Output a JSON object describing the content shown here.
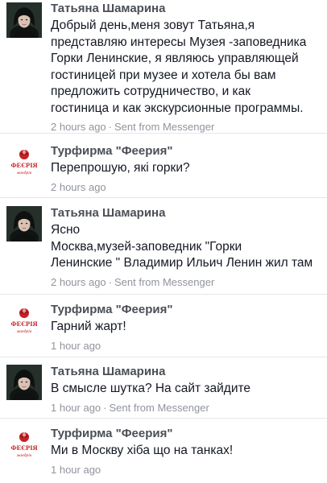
{
  "messages": [
    {
      "sender": "Татьяна Шамарина",
      "avatar": "woman-avatar",
      "lines": [
        "Добрый день,меня зовут Татьяна,я",
        "представляю интересы Музея -заповедника",
        "Горки Ленинские, я являюсь управляющей",
        "гостиницей при музее и хотела бы вам",
        "предложить сотрудничество, и как",
        "гостиница и как экскурсионные программы."
      ],
      "time": "2 hours ago",
      "source": "Sent from Messenger"
    },
    {
      "sender": "Турфирма \"Феерия\"",
      "avatar": "feeria-logo",
      "lines": [
        "Перепрошую, які горки?"
      ],
      "time": "2 hours ago",
      "source": ""
    },
    {
      "sender": "Татьяна Шамарина",
      "avatar": "woman-avatar",
      "lines": [
        "Ясно",
        "Москва,музей-заповедник \"Горки",
        "Ленинские \" Владимир Ильич Ленин жил там"
      ],
      "time": "2 hours ago",
      "source": "Sent from Messenger"
    },
    {
      "sender": "Турфирма \"Феерия\"",
      "avatar": "feeria-logo",
      "lines": [
        "Гарний жарт!"
      ],
      "time": "1 hour ago",
      "source": ""
    },
    {
      "sender": "Татьяна Шамарина",
      "avatar": "woman-avatar",
      "lines": [
        "В смысле шутка? На сайт зайдите"
      ],
      "time": "1 hour ago",
      "source": "Sent from Messenger"
    },
    {
      "sender": "Турфирма \"Феерия\"",
      "avatar": "feeria-logo",
      "lines": [
        "Ми в Москву хіба що на танках!"
      ],
      "time": "1 hour ago",
      "source": ""
    }
  ],
  "logo": {
    "line1": "ФЕЄРІЯ",
    "line2": "мандрів"
  },
  "separator": "·",
  "colors": {
    "name": "#4b4f56",
    "text": "#141823",
    "meta": "#90949c",
    "logo_red": "#c62026"
  }
}
